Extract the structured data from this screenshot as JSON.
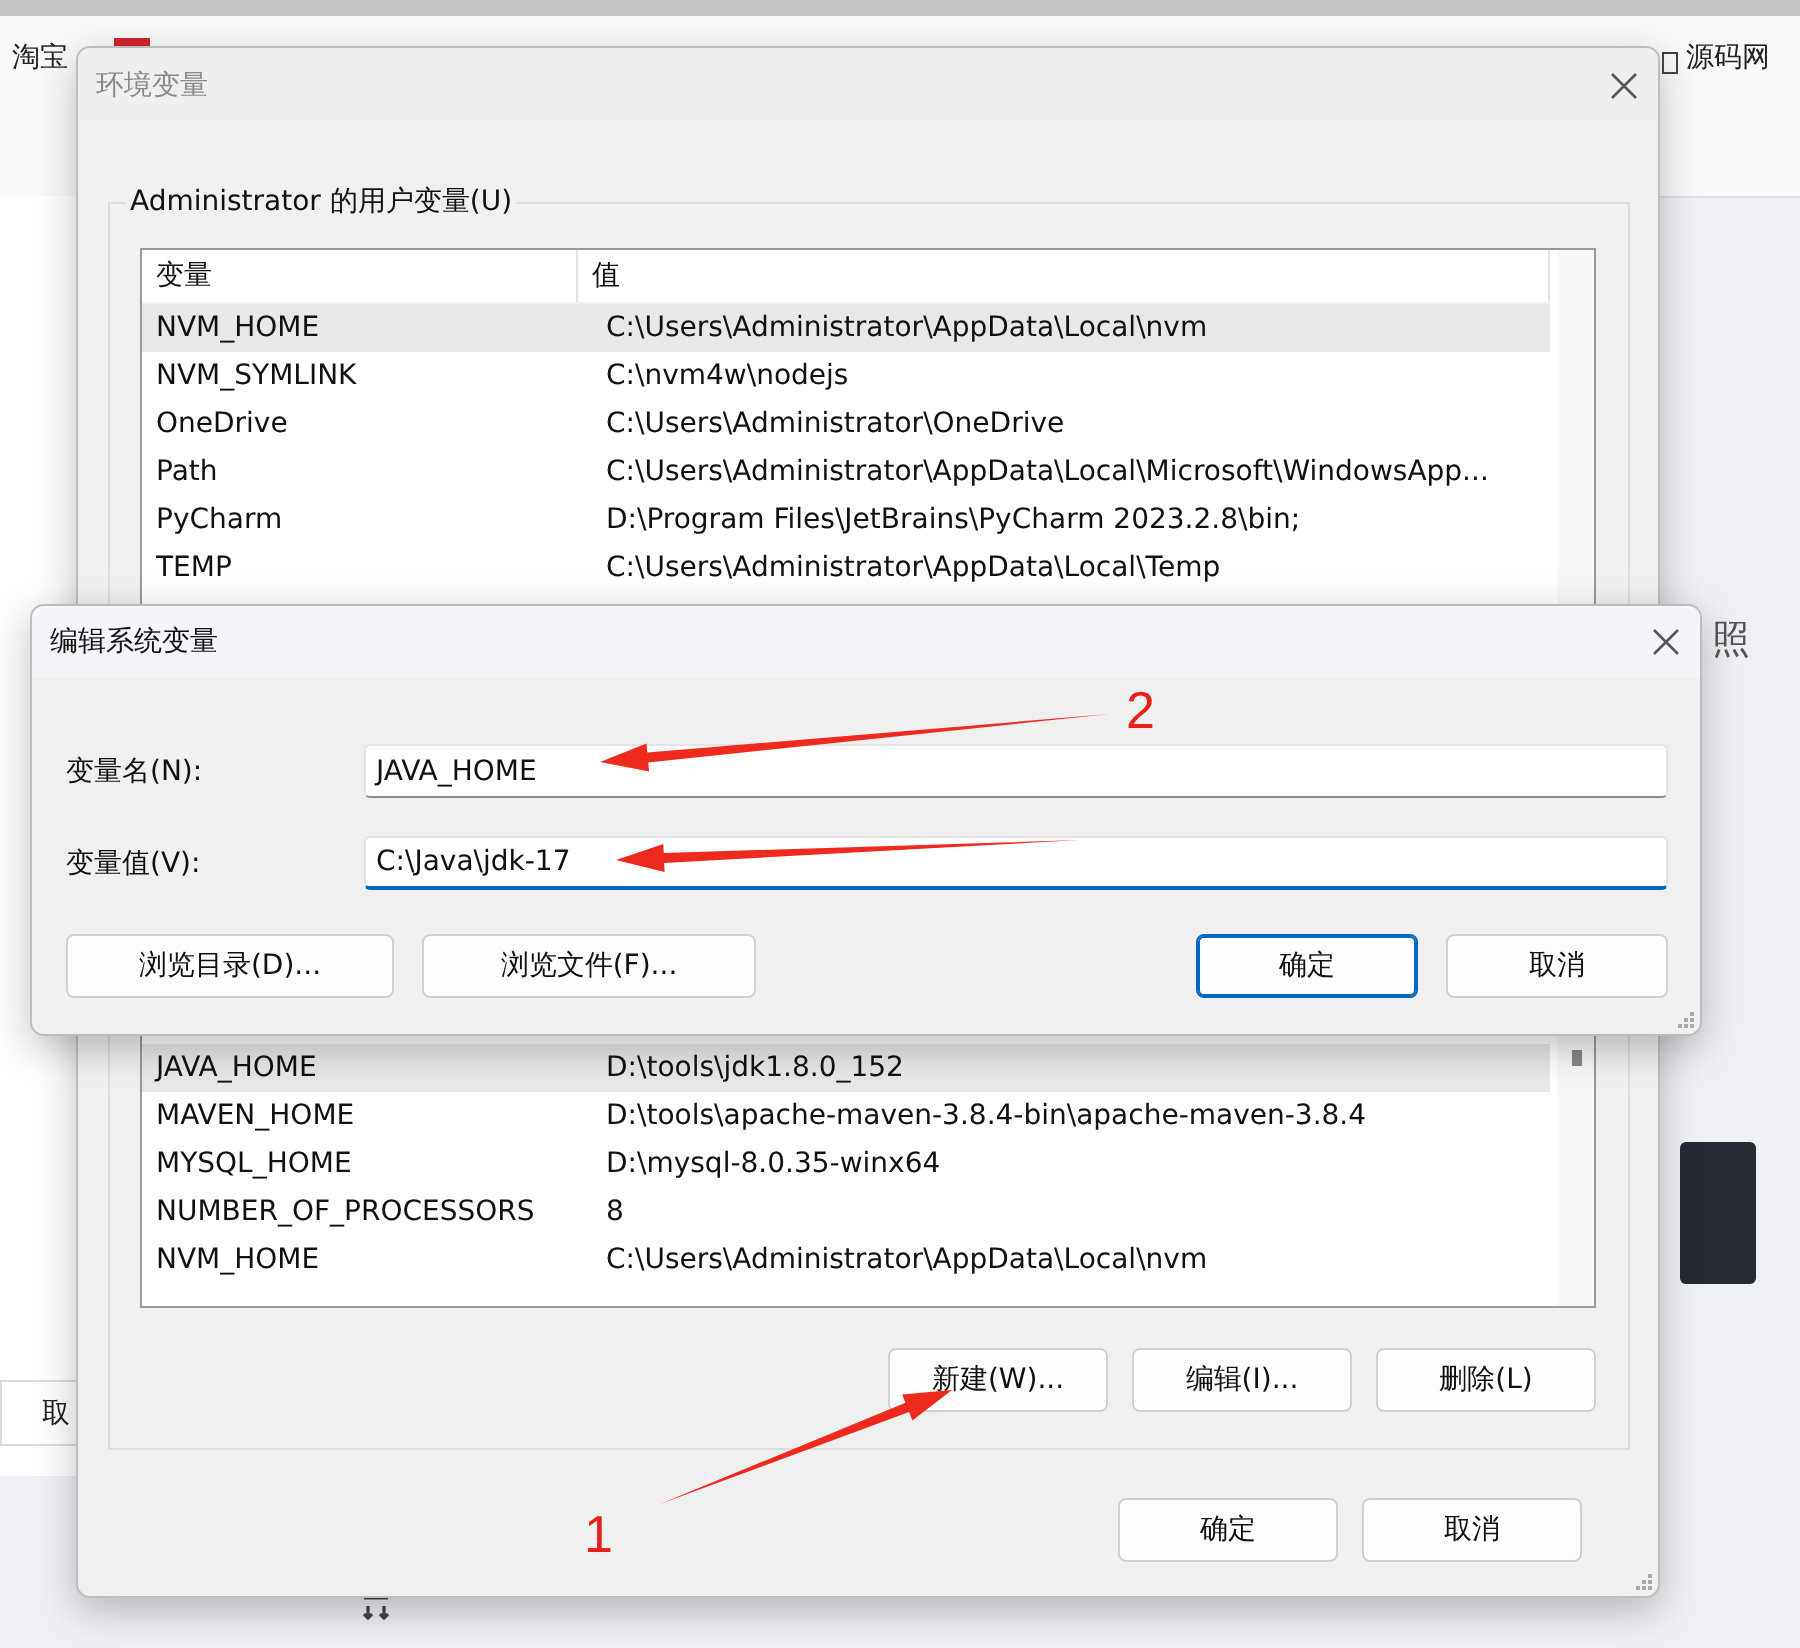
{
  "background": {
    "left_tab": "淘宝",
    "right_link": "源码网",
    "right_char": "照",
    "left_button": "取"
  },
  "env_window": {
    "title": "环境变量",
    "active": false,
    "user_group": {
      "title": "Administrator 的用户变量(U)",
      "columns": [
        "变量",
        "值"
      ],
      "rows": [
        {
          "name": "NVM_HOME",
          "value": "C:\\Users\\Administrator\\AppData\\Local\\nvm",
          "selected": true
        },
        {
          "name": "NVM_SYMLINK",
          "value": "C:\\nvm4w\\nodejs",
          "selected": false
        },
        {
          "name": "OneDrive",
          "value": "C:\\Users\\Administrator\\OneDrive",
          "selected": false
        },
        {
          "name": "Path",
          "value": "C:\\Users\\Administrator\\AppData\\Local\\Microsoft\\WindowsApp...",
          "selected": false
        },
        {
          "name": "PyCharm",
          "value": "D:\\Program Files\\JetBrains\\PyCharm 2023.2.8\\bin;",
          "selected": false
        },
        {
          "name": "TEMP",
          "value": "C:\\Users\\Administrator\\AppData\\Local\\Temp",
          "selected": false
        }
      ]
    },
    "system_group": {
      "rows": [
        {
          "name": "JAVA_HOME",
          "value": "D:\\tools\\jdk1.8.0_152",
          "selected": true
        },
        {
          "name": "MAVEN_HOME",
          "value": "D:\\tools\\apache-maven-3.8.4-bin\\apache-maven-3.8.4",
          "selected": false
        },
        {
          "name": "MYSQL_HOME",
          "value": "D:\\mysql-8.0.35-winx64",
          "selected": false
        },
        {
          "name": "NUMBER_OF_PROCESSORS",
          "value": "8",
          "selected": false
        },
        {
          "name": "NVM_HOME",
          "value": "C:\\Users\\Administrator\\AppData\\Local\\nvm",
          "selected": false
        }
      ],
      "buttons": [
        "新建(W)...",
        "编辑(I)...",
        "删除(L)"
      ]
    },
    "buttons": [
      "确定",
      "取消"
    ]
  },
  "edit_dialog": {
    "title": "编辑系统变量",
    "active": true,
    "fields": [
      {
        "label": "变量名(N):",
        "value": "JAVA_HOME",
        "focused": false
      },
      {
        "label": "变量值(V):",
        "value": "C:\\Java\\jdk-17",
        "focused": true
      }
    ],
    "left_buttons": [
      "浏览目录(D)...",
      "浏览文件(F)..."
    ],
    "right_buttons": [
      {
        "label": "确定",
        "default": true
      },
      {
        "label": "取消",
        "default": false
      }
    ]
  },
  "annotations": [
    "2",
    "1"
  ]
}
